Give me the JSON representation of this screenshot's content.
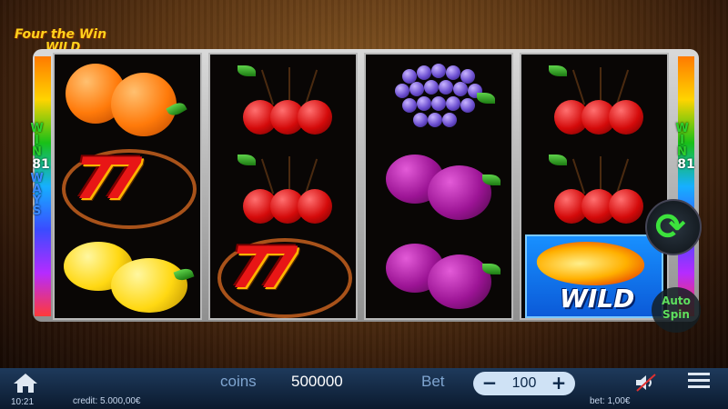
{
  "logo": {
    "line1": "Four the Win",
    "line2": "WILD"
  },
  "ways_panel": {
    "win": "WIN",
    "ways_count": "81",
    "ways": "WAYS"
  },
  "reels": [
    [
      "orange",
      "seven",
      "lemon"
    ],
    [
      "cherry",
      "cherry",
      "seven"
    ],
    [
      "grapes",
      "plum",
      "plum"
    ],
    [
      "cherry",
      "cherry",
      "wild"
    ]
  ],
  "wild_label": "WILD",
  "seven_label": "77",
  "controls": {
    "spin_icon": "refresh-arrows-icon",
    "auto_spin": "Auto Spin"
  },
  "bottom_bar": {
    "coins_label": "coins",
    "coins_value": "500000",
    "bet_label": "Bet",
    "bet_value": "100",
    "bet_minus": "−",
    "bet_plus": "+",
    "clock": "10:21",
    "credit": "credit: 5.000,00€",
    "bet_amount": "bet: 1,00€"
  },
  "colors": {
    "bar_top": "#1e3a5c",
    "accent_green": "#3ce23c",
    "reel_bg": "#090605"
  }
}
